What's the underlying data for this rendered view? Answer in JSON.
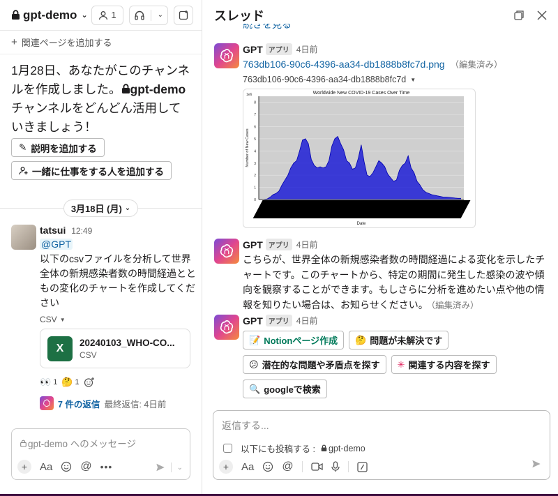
{
  "channel": {
    "name": "gpt-demo",
    "members_count": "1",
    "add_page_label": "関連ページを追加する",
    "intro_text_before": "1月28日、あなたがこのチャンネルを作成しました。",
    "intro_channel": "gpt-demo",
    "intro_text_after": "チャンネルをどんどん活用していきましょう！",
    "add_description_button": "説明を追加する",
    "add_people_button": "一緒に仕事をする人を追加する",
    "date_divider": "3月18日 (月)"
  },
  "message": {
    "user": "tatsui",
    "time": "12:49",
    "mention": "@GPT",
    "text": "以下のcsvファイルを分析して世界全体の新規感染者数の時間経過とともの変化のチャートを作成してください",
    "file_type_label": "CSV",
    "file_name": "20240103_WHO-CO...",
    "file_kind": "CSV",
    "reactions": [
      {
        "emoji": "👀",
        "count": "1"
      },
      {
        "emoji": "🤔",
        "count": "1"
      }
    ],
    "replies_label": "7 件の返信",
    "last_reply": "最終返信: 4日前"
  },
  "composer_left": {
    "placeholder": "gpt-demo へのメッセージ"
  },
  "thread": {
    "title": "スレッド",
    "cut_text": "続きを見る",
    "messages": [
      {
        "user": "GPT",
        "badge": "アプリ",
        "time": "4日前",
        "link": "763db106-90c6-4396-aa34-db1888b8fc7d.png",
        "edited": "（編集済み）",
        "file_label": "763db106-90c6-4396-aa34-db1888b8fc7d"
      },
      {
        "user": "GPT",
        "badge": "アプリ",
        "time": "4日前",
        "text": "こちらが、世界全体の新規感染者数の時間経過による変化を示したチャートです。このチャートから、特定の期間に発生した感染の波や傾向を観察することができます。もしさらに分析を進めたい点や他の情報を知りたい場合は、お知らせください。",
        "edited": "（編集済み）"
      },
      {
        "user": "GPT",
        "badge": "アプリ",
        "time": "4日前",
        "buttons": [
          {
            "icon": "📝",
            "label": "Notionページ作成"
          },
          {
            "icon": "🤔",
            "label": "問題が未解決です"
          },
          {
            "icon": "😕",
            "label": "潜在的な問題や矛盾点を探す"
          },
          {
            "icon": "✳",
            "label": "関連する内容を探す"
          },
          {
            "icon": "🔍",
            "label": "googleで検索"
          }
        ]
      }
    ]
  },
  "composer_right": {
    "placeholder": "返信する...",
    "also_post": "以下にも投稿する :",
    "also_channel": "gpt-demo"
  },
  "chart_data": {
    "type": "area",
    "title": "Worldwide New COVID-19 Cases Over Time",
    "xlabel": "Date",
    "ylabel": "Number of New Cases",
    "y_multiplier": "1e6",
    "y_ticks": [
      "0",
      "1",
      "2",
      "3",
      "4",
      "5",
      "6",
      "7",
      "8"
    ],
    "ylim": [
      0,
      8.5
    ],
    "grid": true,
    "color": "#1f1fd6",
    "series": [
      {
        "values": [
          0.01,
          0.05,
          0.2,
          0.4,
          0.5,
          0.7,
          1.2,
          1.6,
          2.0,
          2.6,
          3.0,
          3.2,
          4.0,
          4.9,
          5.0,
          4.6,
          3.3,
          2.8,
          2.6,
          2.7,
          2.6,
          2.7,
          3.2,
          4.4,
          5.0,
          5.2,
          4.6,
          4.1,
          3.2,
          3.0,
          2.5,
          2.6,
          3.4,
          4.5,
          3.1,
          2.0,
          1.9,
          2.2,
          2.7,
          3.2,
          3.0,
          2.7,
          2.1,
          1.8,
          1.5,
          1.6,
          2.4,
          2.8,
          3.0,
          3.6,
          2.6,
          2.2,
          1.5,
          1.2,
          0.8,
          0.6,
          0.5,
          0.4,
          0.35,
          0.3,
          0.25,
          0.2,
          0.2,
          0.18,
          0.15,
          0.12,
          0.1,
          0.1
        ]
      }
    ]
  }
}
